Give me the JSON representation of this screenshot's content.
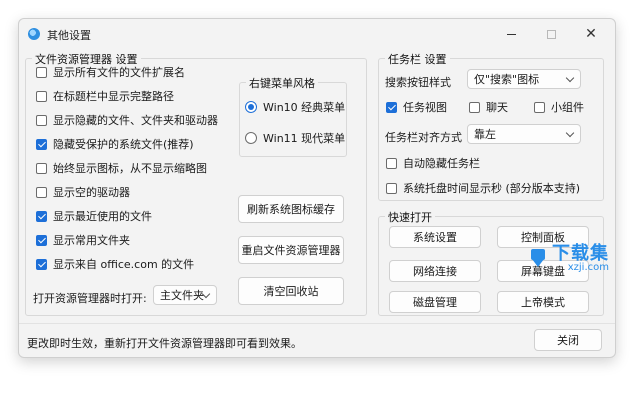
{
  "window": {
    "title": "其他设置"
  },
  "explorer": {
    "group_label": "文件资源管理器 设置",
    "options": [
      {
        "label": "显示所有文件的文件扩展名",
        "checked": false
      },
      {
        "label": "在标题栏中显示完整路径",
        "checked": false
      },
      {
        "label": "显示隐藏的文件、文件夹和驱动器",
        "checked": false
      },
      {
        "label": "隐藏受保护的系统文件(推荐)",
        "checked": true
      },
      {
        "label": "始终显示图标，从不显示缩略图",
        "checked": false
      },
      {
        "label": "显示空的驱动器",
        "checked": false
      },
      {
        "label": "显示最近使用的文件",
        "checked": true
      },
      {
        "label": "显示常用文件夹",
        "checked": true
      },
      {
        "label": "显示来自 office.com 的文件",
        "checked": true
      }
    ],
    "open_to_label": "打开资源管理器时打开:",
    "open_to_value": "主文件夹",
    "context_menu": {
      "group_label": "右键菜单风格",
      "options": [
        {
          "label": "Win10 经典菜单",
          "selected": true
        },
        {
          "label": "Win11 现代菜单",
          "selected": false
        }
      ]
    },
    "buttons": {
      "refresh_icons": "刷新系统图标缓存",
      "restart_explorer": "重启文件资源管理器",
      "empty_recycle": "清空回收站"
    }
  },
  "taskbar": {
    "group_label": "任务栏 设置",
    "search_label": "搜索按钮样式",
    "search_value": "仅\"搜索\"图标",
    "task_view": {
      "label": "任务视图",
      "checked": true
    },
    "chat": {
      "label": "聊天",
      "checked": false
    },
    "widgets": {
      "label": "小组件",
      "checked": false
    },
    "align_label": "任务栏对齐方式",
    "align_value": "靠左",
    "auto_hide": {
      "label": "自动隐藏任务栏",
      "checked": false
    },
    "tray_seconds": {
      "label": "系统托盘时间显示秒 (部分版本支持)",
      "checked": false
    }
  },
  "quick_open": {
    "group_label": "快速打开",
    "buttons": [
      "系统设置",
      "控制面板",
      "网络连接",
      "屏幕键盘",
      "磁盘管理",
      "上帝模式"
    ]
  },
  "status": {
    "text": "更改即时生效，重新打开文件资源管理器即可看到效果。"
  },
  "close_button": "关闭",
  "watermark": {
    "big": "下载集",
    "small": "xzji.com"
  },
  "colors": {
    "accent": "#1d6fd8",
    "watermark": "#2a8ee8"
  }
}
